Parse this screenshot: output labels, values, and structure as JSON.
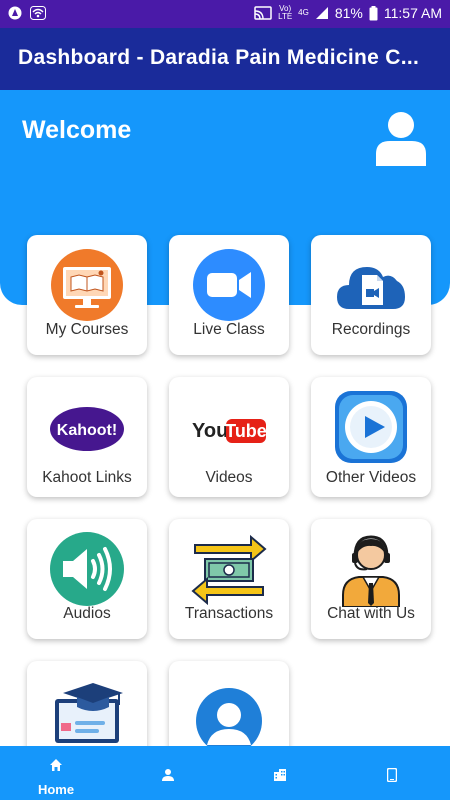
{
  "status_bar": {
    "volte": "Vo)",
    "lte": "LTE",
    "net4g": "4G",
    "battery_percent": "81%",
    "time": "11:57 AM"
  },
  "app_bar": {
    "title": "Dashboard - Daradia Pain Medicine C..."
  },
  "hero": {
    "welcome": "Welcome"
  },
  "cards": [
    {
      "label": "My Courses",
      "icon": "course-screen-icon"
    },
    {
      "label": "Live Class",
      "icon": "zoom-camera-icon"
    },
    {
      "label": "Recordings",
      "icon": "cloud-video-icon"
    },
    {
      "label": "Kahoot Links",
      "icon": "kahoot-logo-icon",
      "logo_text": "Kahoot!"
    },
    {
      "label": "Videos",
      "icon": "youtube-logo-icon",
      "logo_text_you": "You",
      "logo_text_tube": "Tube"
    },
    {
      "label": "Other Videos",
      "icon": "play-button-icon"
    },
    {
      "label": "Audios",
      "icon": "speaker-icon"
    },
    {
      "label": "Transactions",
      "icon": "money-transfer-icon"
    },
    {
      "label": "Chat with Us",
      "icon": "support-agent-icon"
    },
    {
      "label": "",
      "icon": "graduation-screen-icon"
    },
    {
      "label": "",
      "icon": "user-circle-icon"
    }
  ],
  "bottom_nav": [
    {
      "label": "Home",
      "icon": "home-icon"
    },
    {
      "label": "",
      "icon": "person-icon"
    },
    {
      "label": "",
      "icon": "building-icon"
    },
    {
      "label": "",
      "icon": "phone-icon"
    }
  ],
  "colors": {
    "status_bar": "#4a1aa8",
    "app_bar": "#1a2b9a",
    "accent": "#1597fb"
  }
}
